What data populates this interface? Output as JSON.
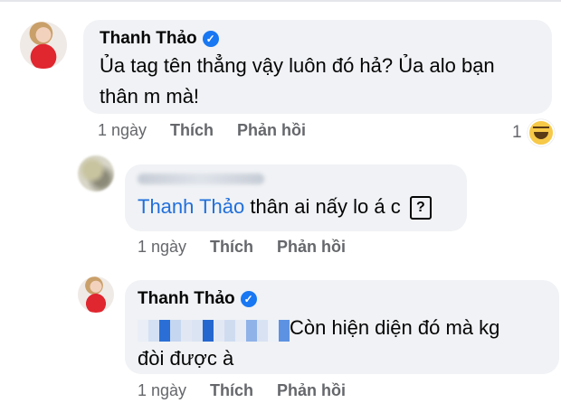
{
  "comments": [
    {
      "author": "Thanh Thảo",
      "verified": true,
      "text": "Ủa tag tên thẳng vậy luôn đó hả? Ủa alo bạn thân m mà!",
      "text_line1": "Ủa tag tên thẳng vậy luôn đó hả? Ủa alo bạn",
      "text_line2": "thân m mà!",
      "time": "1 ngày",
      "like_label": "Thích",
      "reply_label": "Phản hồi",
      "reaction_count": "1",
      "reaction_icon": "haha-emoji-icon"
    },
    {
      "author": "Nancy Nguyen",
      "author_blurred": true,
      "mention": "Thanh Thảo",
      "text": "thân ai nấy lo á c",
      "trailing_icon": "question-box-icon",
      "trailing_symbol": "?",
      "time": "1 ngày",
      "like_label": "Thích",
      "reply_label": "Phản hồi"
    },
    {
      "author": "Thanh Thảo",
      "verified": true,
      "mention": "Nancy Nguyen",
      "mention_blurred": true,
      "text_line1": "Còn hiện diện đó mà kg",
      "text_line2": "đòi được à",
      "time": "1 ngày",
      "like_label": "Thích",
      "reply_label": "Phản hồi"
    }
  ],
  "colors": {
    "bubble": "#f0f2f5",
    "mention": "#216fdb",
    "meta": "#65676b",
    "verified": "#1877f2"
  }
}
